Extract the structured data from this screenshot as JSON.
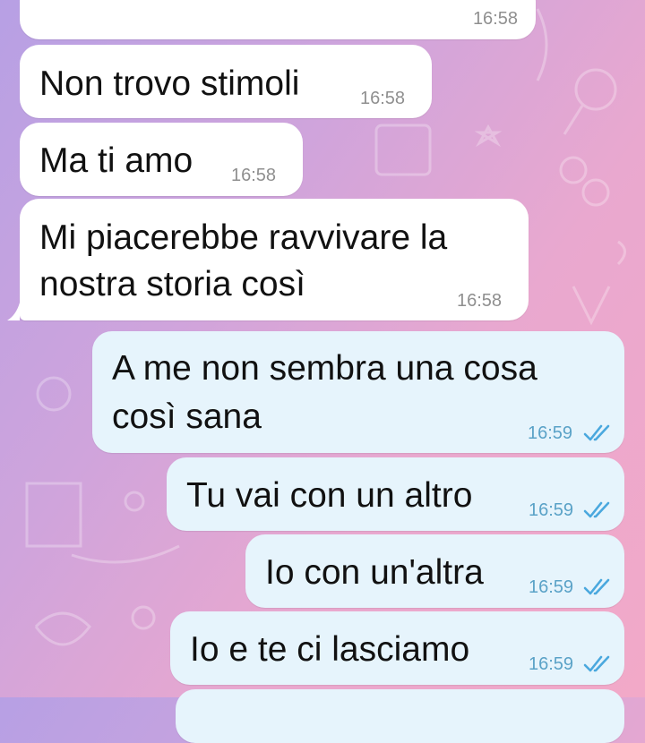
{
  "chat": {
    "messages": [
      {
        "id": "m0",
        "side": "in",
        "text": "",
        "time": "16:58"
      },
      {
        "id": "m1",
        "side": "in",
        "text": "Non trovo stimoli",
        "time": "16:58"
      },
      {
        "id": "m2",
        "side": "in",
        "text": "Ma ti amo",
        "time": "16:58"
      },
      {
        "id": "m3",
        "side": "in",
        "lines": [
          "Mi piacerebbe ravvivare la",
          "nostra storia così"
        ],
        "time": "16:58"
      },
      {
        "id": "m4",
        "side": "out",
        "lines": [
          "A me non sembra una cosa",
          "così sana"
        ],
        "time": "16:59",
        "status": "read-double-check-icon"
      },
      {
        "id": "m5",
        "side": "out",
        "text": "Tu vai con un altro",
        "time": "16:59",
        "status": "read-double-check-icon"
      },
      {
        "id": "m6",
        "side": "out",
        "text": "Io con un'altra",
        "time": "16:59",
        "status": "read-double-check-icon"
      },
      {
        "id": "m7",
        "side": "out",
        "text": "Io e te ci lasciamo",
        "time": "16:59",
        "status": "read-double-check-icon"
      },
      {
        "id": "m8",
        "side": "out",
        "text": "",
        "time": ""
      }
    ]
  },
  "colors": {
    "incoming_bubble": "#ffffff",
    "outgoing_bubble": "#e6f4fc",
    "read_check": "#4aa8de"
  }
}
